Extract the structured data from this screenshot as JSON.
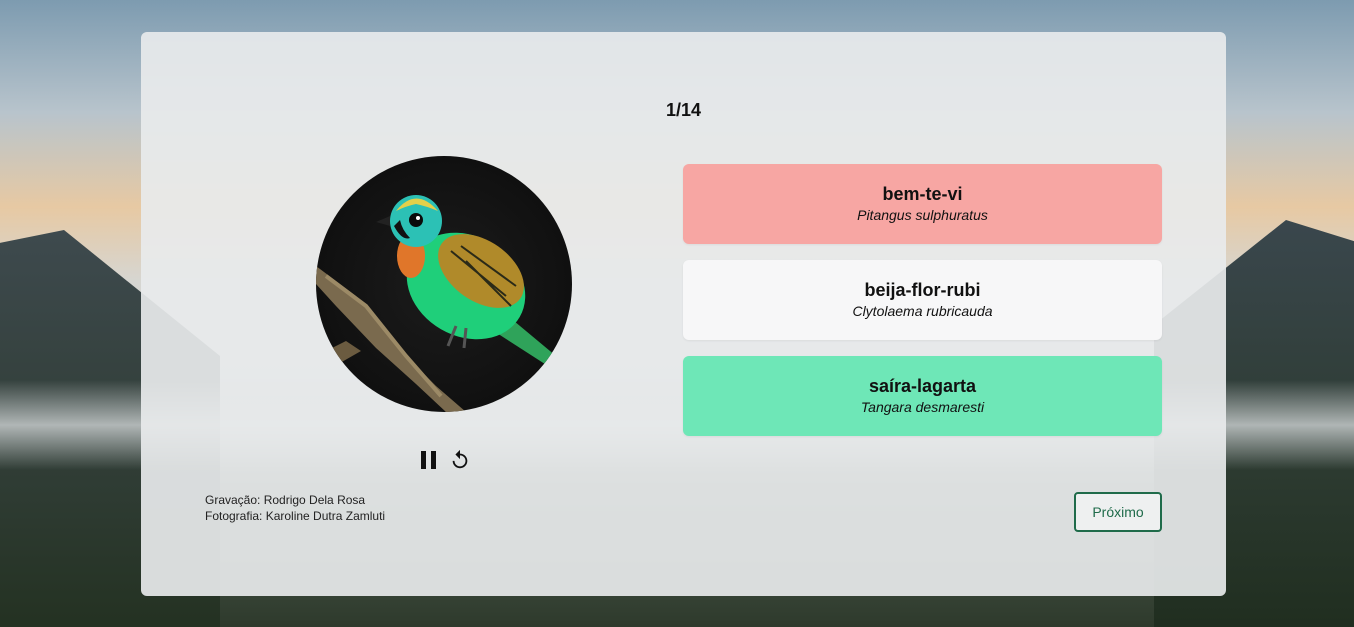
{
  "progress": {
    "counter_text": "1/14"
  },
  "media": {
    "photo_icon": "bird-photo",
    "pause_icon": "pause-icon",
    "replay_icon": "replay-icon"
  },
  "options": [
    {
      "common_name": "bem-te-vi",
      "scientific_name": "Pitangus sulphuratus",
      "state": "wrong",
      "color": "#f7a6a3"
    },
    {
      "common_name": "beija-flor-rubi",
      "scientific_name": "Clytolaema rubricauda",
      "state": "neutral",
      "color": "#f7f7f8"
    },
    {
      "common_name": "saíra-lagarta",
      "scientific_name": "Tangara desmaresti",
      "state": "correct",
      "color": "#6ee7b7"
    }
  ],
  "credits": {
    "recording": "Gravação: Rodrigo Dela Rosa",
    "photo": "Fotografia: Karoline Dutra Zamluti"
  },
  "buttons": {
    "next_label": "Próximo"
  },
  "colors": {
    "accent": "#1f6b4a"
  }
}
